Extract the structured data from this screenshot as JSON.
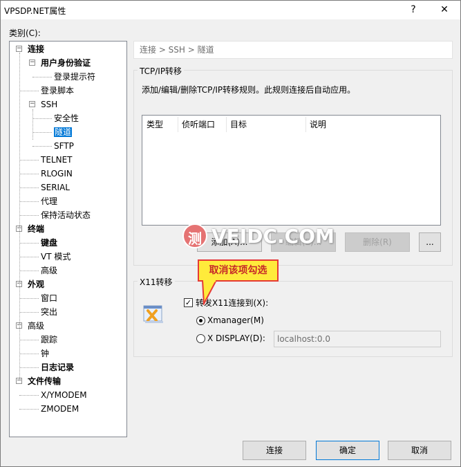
{
  "window": {
    "title": "VPSDP.NET属性",
    "help": "?",
    "close": "✕"
  },
  "category_label": "类别(C):",
  "tree": [
    {
      "label": "连接",
      "bold": true,
      "level": 0,
      "expander": "−"
    },
    {
      "label": "用户身份验证",
      "bold": true,
      "level": 1,
      "expander": "−"
    },
    {
      "label": "登录提示符",
      "bold": false,
      "level": 2
    },
    {
      "label": "登录脚本",
      "bold": false,
      "level": 1
    },
    {
      "label": "SSH",
      "bold": false,
      "level": 1,
      "expander": "−"
    },
    {
      "label": "安全性",
      "bold": false,
      "level": 2
    },
    {
      "label": "隧道",
      "bold": false,
      "level": 2,
      "selected": true
    },
    {
      "label": "SFTP",
      "bold": false,
      "level": 2
    },
    {
      "label": "TELNET",
      "bold": false,
      "level": 1
    },
    {
      "label": "RLOGIN",
      "bold": false,
      "level": 1
    },
    {
      "label": "SERIAL",
      "bold": false,
      "level": 1
    },
    {
      "label": "代理",
      "bold": false,
      "level": 1
    },
    {
      "label": "保持活动状态",
      "bold": false,
      "level": 1
    },
    {
      "label": "终端",
      "bold": true,
      "level": 0,
      "expander": "−"
    },
    {
      "label": "键盘",
      "bold": true,
      "level": 1
    },
    {
      "label": "VT 模式",
      "bold": false,
      "level": 1
    },
    {
      "label": "高级",
      "bold": false,
      "level": 1
    },
    {
      "label": "外观",
      "bold": true,
      "level": 0,
      "expander": "−"
    },
    {
      "label": "窗口",
      "bold": false,
      "level": 1
    },
    {
      "label": "突出",
      "bold": false,
      "level": 1
    },
    {
      "label": "高级",
      "bold": false,
      "level": 0,
      "expander": "−"
    },
    {
      "label": "跟踪",
      "bold": false,
      "level": 1
    },
    {
      "label": "钟",
      "bold": false,
      "level": 1
    },
    {
      "label": "日志记录",
      "bold": true,
      "level": 1
    },
    {
      "label": "文件传输",
      "bold": true,
      "level": 0,
      "expander": "−"
    },
    {
      "label": "X/YMODEM",
      "bold": false,
      "level": 1
    },
    {
      "label": "ZMODEM",
      "bold": false,
      "level": 1
    }
  ],
  "breadcrumb": "连接 > SSH > 隧道",
  "tcpip": {
    "title": "TCP/IP转移",
    "description": "添加/编辑/删除TCP/IP转移规则。此规则连接后自动应用。",
    "columns": [
      "类型",
      "侦听端口",
      "目标",
      "说明"
    ],
    "add_button": "添加(A)...",
    "edit_button": "编辑(E)...",
    "delete_button": "删除(R)",
    "more_button": "..."
  },
  "x11": {
    "title": "X11转移",
    "forward_label": "转发X11连接到(X):",
    "forward_checked": true,
    "xmanager_label": "Xmanager(M)",
    "xdisplay_label": "X DISPLAY(D):",
    "xdisplay_value": "localhost:0.0"
  },
  "callout": "取消该项勾选",
  "watermark": {
    "text": "VEIDC.COM",
    "badge": "测"
  },
  "footer": {
    "connect": "连接",
    "ok": "确定",
    "cancel": "取消"
  },
  "colors": {
    "selection": "#0078d7",
    "callout_border": "#e53935",
    "callout_bg": "#ffeb3b",
    "watermark_badge": "#e57373"
  }
}
